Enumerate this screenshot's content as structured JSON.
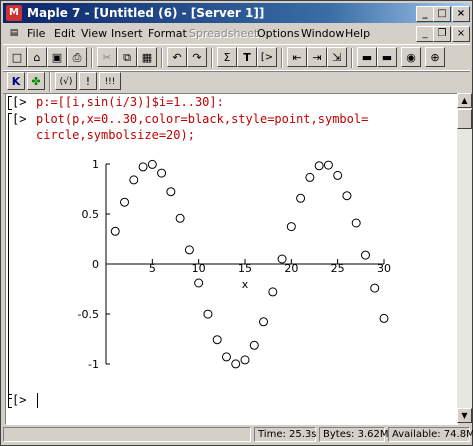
{
  "window": {
    "title": "Maple 7 - [Untitled (6) - [Server 1]]",
    "app_icon_glyph": "M"
  },
  "title_buttons": {
    "minimize": "_",
    "maximize": "□",
    "close": "×"
  },
  "menu": [
    "File",
    "Edit",
    "View",
    "Insert",
    "Format",
    "Spreadsheet",
    "Options",
    "Window",
    "Help"
  ],
  "menu_disabled": [
    "Spreadsheet"
  ],
  "toolbar2": {
    "sigma": "Σ",
    "text": "T",
    "prompt": "[>"
  },
  "context_bar": {
    "btn1": "K",
    "btn3": "(√)",
    "btn4": "!",
    "btn5": "!!!"
  },
  "worksheet": {
    "prompt": "[>",
    "line1": "p:=[[i,sin(i/3)]$i=1..30]:",
    "line2a": "plot(p,x=0..30,color=black,style=point,symbol=",
    "line2b": "circle,symbolsize=20);",
    "final_prompt": "[>"
  },
  "chart_data": {
    "type": "scatter",
    "marker": "circle",
    "color": "#000000",
    "x": [
      1,
      2,
      3,
      4,
      5,
      6,
      7,
      8,
      9,
      10,
      11,
      12,
      13,
      14,
      15,
      16,
      17,
      18,
      19,
      20,
      21,
      22,
      23,
      24,
      25,
      26,
      27,
      28,
      29,
      30
    ],
    "y": [
      0.327,
      0.618,
      0.841,
      0.971,
      0.996,
      0.909,
      0.723,
      0.457,
      0.141,
      -0.19,
      -0.501,
      -0.757,
      -0.929,
      -0.999,
      -0.959,
      -0.813,
      -0.578,
      -0.279,
      0.05,
      0.374,
      0.657,
      0.866,
      0.982,
      0.989,
      0.886,
      0.683,
      0.41,
      0.089,
      -0.241,
      -0.544
    ],
    "xlabel": "x",
    "xlim": [
      0,
      30
    ],
    "ylim": [
      -1,
      1
    ],
    "xticks": [
      "0",
      "5",
      "10",
      "15",
      "20",
      "25",
      "30"
    ],
    "yticks": [
      "1",
      "0.5",
      "0",
      "-0.5",
      "-1"
    ],
    "grid": false
  },
  "status": {
    "time": "Time: 25.3s",
    "bytes": "Bytes: 3.62M",
    "available": "Available: 74.8M"
  }
}
